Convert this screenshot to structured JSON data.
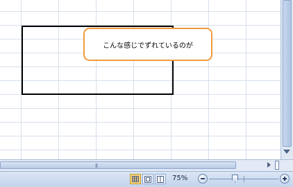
{
  "sheet": {
    "callout_text": "こんな感じでずれているのが"
  },
  "statusbar": {
    "zoom_label": "75%",
    "zoom_percent": 75,
    "views": [
      "normal-view",
      "page-layout-view",
      "page-break-preview"
    ],
    "active_view": "normal-view"
  },
  "colors": {
    "callout_border": "#f09a3e",
    "gridline": "#d7dfec",
    "active_view_button": "#fbd677"
  }
}
